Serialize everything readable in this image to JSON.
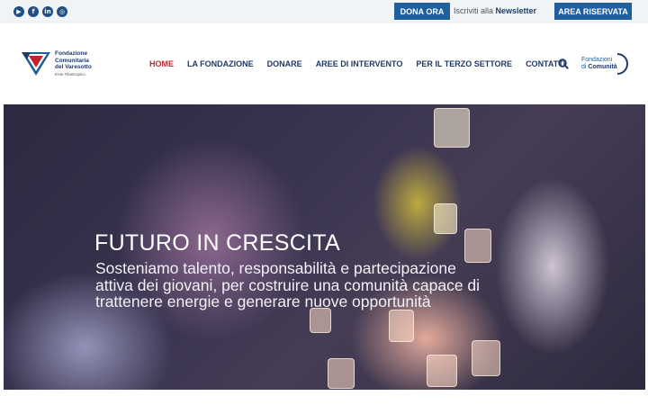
{
  "topbar": {
    "social": [
      {
        "icon": "youtube-icon",
        "glyph": "▶"
      },
      {
        "icon": "facebook-icon",
        "glyph": "f"
      },
      {
        "icon": "linkedin-icon",
        "glyph": "in"
      },
      {
        "icon": "instagram-icon",
        "glyph": "◎"
      }
    ],
    "dona_label": "DONA ORA",
    "newsletter_prefix": "Iscriviti alla ",
    "newsletter_strong": "Newsletter",
    "area_label": "AREA RISERVATA"
  },
  "logo": {
    "line1": "Fondazione",
    "line2": "Comunitaria",
    "line3": "del Varesotto",
    "line4": "Ente Filantropico"
  },
  "nav": [
    {
      "label": "HOME",
      "active": true
    },
    {
      "label": "LA FONDAZIONE",
      "active": false
    },
    {
      "label": "DONARE",
      "active": false
    },
    {
      "label": "AREE DI INTERVENTO",
      "active": false
    },
    {
      "label": "PER IL TERZO SETTORE",
      "active": false
    },
    {
      "label": "CONTATTI",
      "active": false
    }
  ],
  "partner": {
    "line1": "Fondazioni",
    "line2_prefix": "di ",
    "line2_strong": "Comunità"
  },
  "hero": {
    "title": "FUTURO IN CRESCITA",
    "subtitle": "Sosteniamo talento, responsabilità e partecipazione attiva dei giovani, per costruire una comunità capace di trattenere energie e generare nuove opportunità"
  },
  "colors": {
    "brand_blue": "#1f5f9d",
    "navy": "#1f3a66",
    "active_red": "#c1262e"
  }
}
